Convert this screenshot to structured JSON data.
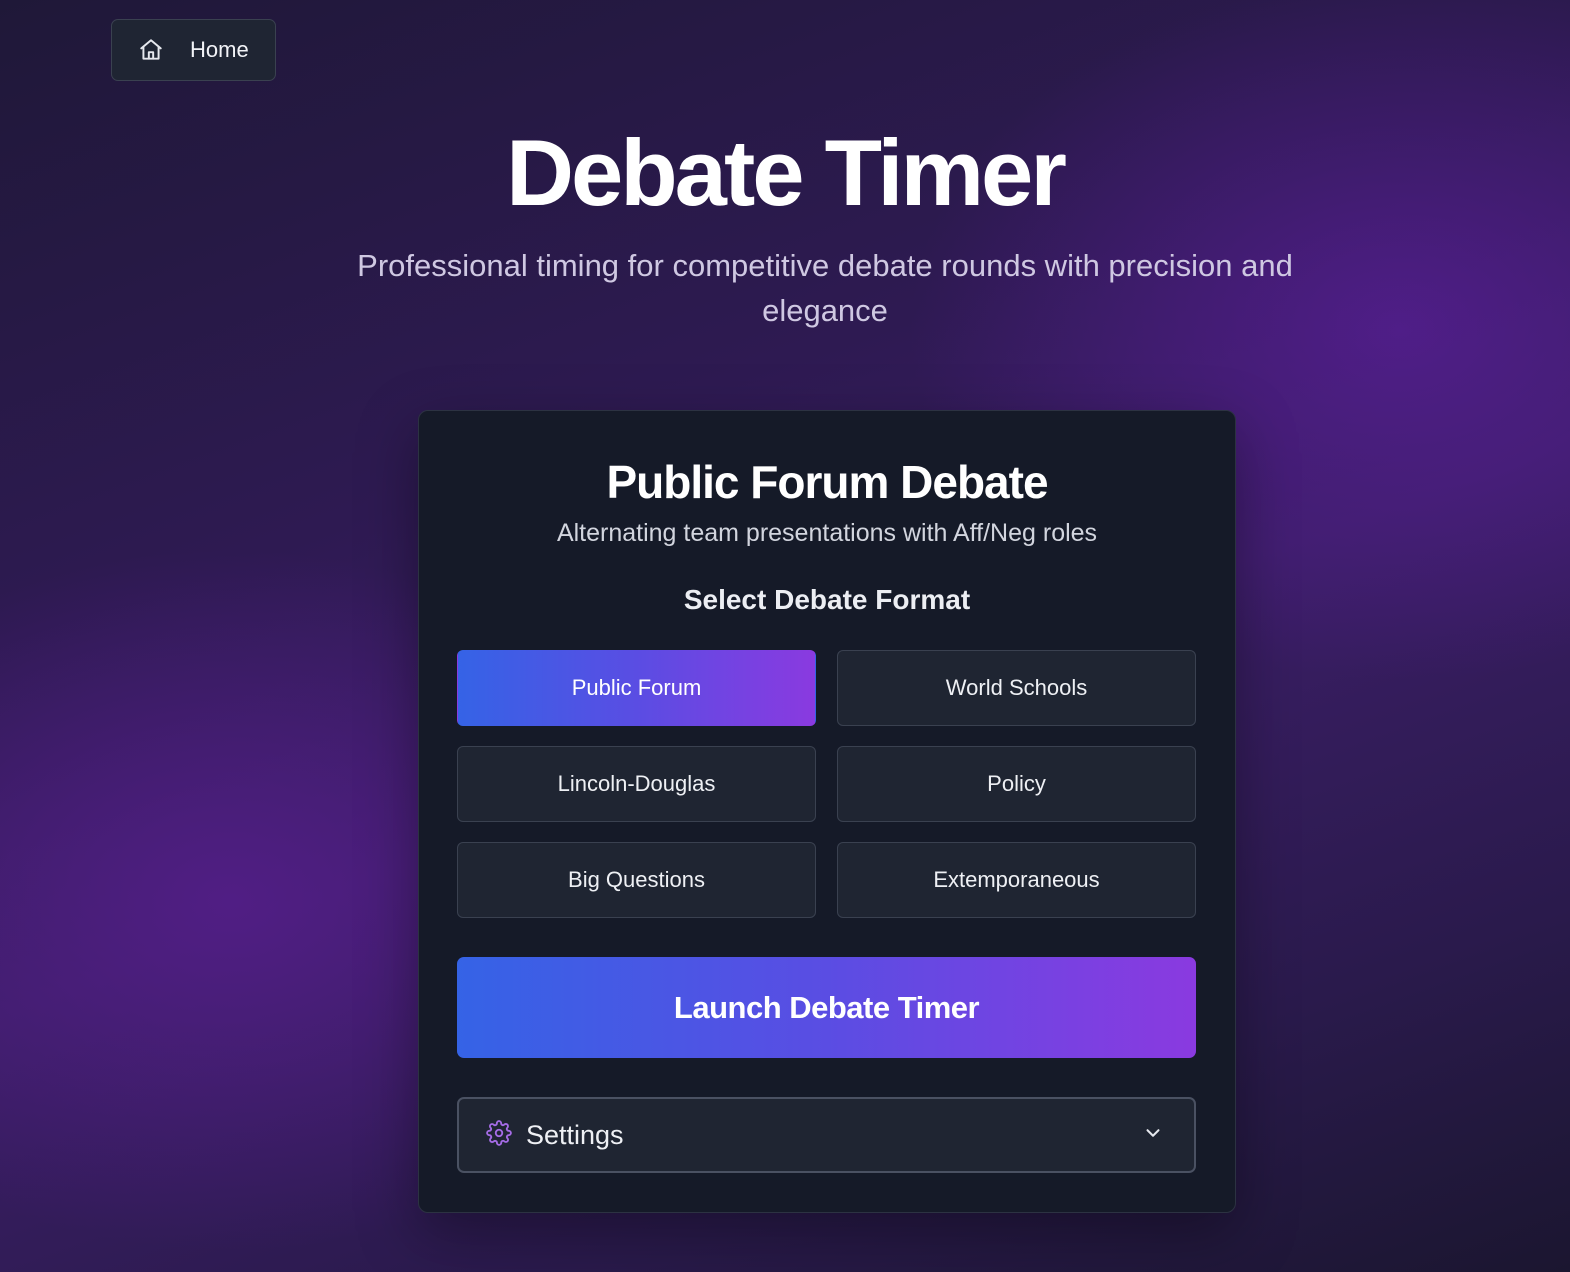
{
  "nav": {
    "home_label": "Home",
    "home_icon": "home-icon"
  },
  "hero": {
    "title": "Debate Timer",
    "subtitle": "Professional timing for competitive debate rounds with precision and elegance"
  },
  "card": {
    "title": "Public Forum Debate",
    "description": "Alternating team presentations with Aff/Neg roles",
    "format_heading": "Select Debate Format",
    "formats": [
      {
        "label": "Public Forum",
        "selected": true
      },
      {
        "label": "World Schools",
        "selected": false
      },
      {
        "label": "Lincoln-Douglas",
        "selected": false
      },
      {
        "label": "Policy",
        "selected": false
      },
      {
        "label": "Big Questions",
        "selected": false
      },
      {
        "label": "Extemporaneous",
        "selected": false
      }
    ],
    "launch_label": "Launch Debate Timer",
    "settings": {
      "label": "Settings",
      "icon": "gear-icon",
      "toggle_icon": "chevron-down-icon",
      "expanded": false
    }
  },
  "colors": {
    "accent_gradient_start": "#3563e6",
    "accent_gradient_end": "#8a3ae0",
    "card_bg": "#151a28",
    "button_bg": "#1f2532",
    "settings_icon_color": "#a56ce6"
  }
}
